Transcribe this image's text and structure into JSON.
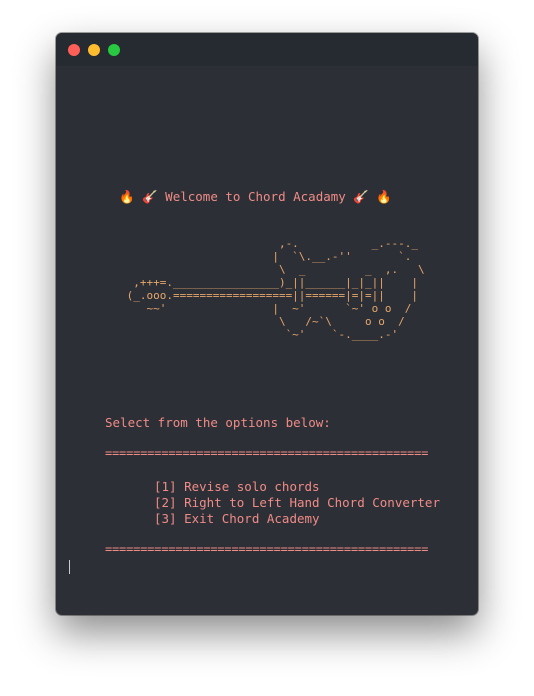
{
  "terminal": {
    "welcome": "🔥 🎸 Welcome to Chord Acadamy 🎸 🔥",
    "ascii_art": "                        ,-.           _.---._\n                       |  `\\.__.-''       `.\n                        \\  _         _  ,.   \\\n  ,+++=.________________)_||______|_|_||    |\n (_.ooo.==================||======|=|=||    |\n    ~~'                |  ~'      `~' o o  /\n                        \\   /~`\\     o o  /\n                         `~'    `-.____.-'",
    "prompt": "Select from the options below:",
    "divider": "==============================================",
    "options": [
      "[1] Revise solo chords",
      "[2] Right to Left Hand Chord Converter",
      "[3] Exit Chord Academy"
    ]
  },
  "colors": {
    "background": "#2c2f36",
    "titlebar": "#262a31",
    "accent_text": "#f08b86",
    "ascii": "#e7a66b"
  }
}
